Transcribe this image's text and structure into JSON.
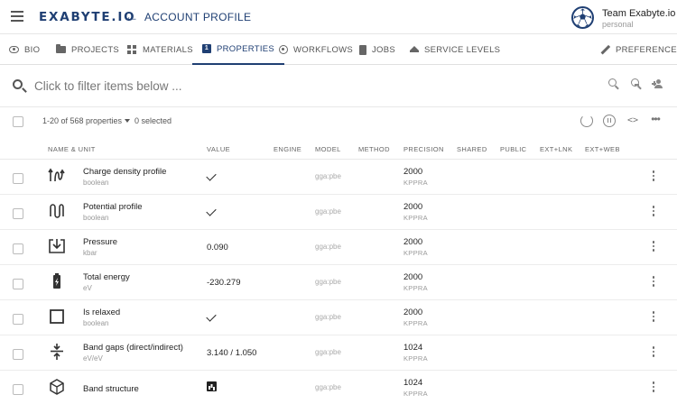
{
  "header": {
    "logo": "EXABYTE.IO",
    "page_title": "ACCOUNT PROFILE",
    "team_name": "Team Exabyte.io",
    "team_sub": "personal"
  },
  "tabs": [
    {
      "label": "BIO",
      "icon": "eye-icon"
    },
    {
      "label": "PROJECTS",
      "icon": "folder-icon"
    },
    {
      "label": "MATERIALS",
      "icon": "grid-icon"
    },
    {
      "label": "PROPERTIES",
      "icon": "one-icon",
      "active": true
    },
    {
      "label": "WORKFLOWS",
      "icon": "radio-icon"
    },
    {
      "label": "JOBS",
      "icon": "document-icon"
    },
    {
      "label": "SERVICE LEVELS",
      "icon": "layers-icon"
    },
    {
      "label": "PREFERENCES",
      "icon": "pencil-icon"
    }
  ],
  "search": {
    "placeholder": "Click to filter items below ..."
  },
  "toolbar": {
    "count_label": "1-20 of 568 properties",
    "selected_label": "0 selected"
  },
  "columns": [
    "NAME & UNIT",
    "VALUE",
    "ENGINE",
    "MODEL",
    "METHOD",
    "PRECISION",
    "SHARED",
    "PUBLIC",
    "EXT+LNK",
    "EXT+WEB"
  ],
  "rows": [
    {
      "name": "Charge density profile",
      "unit": "boolean",
      "value": "",
      "value_type": "check",
      "model": "gga:pbe",
      "precision": "2000",
      "precision_unit": "KPPRA",
      "icon": "charge-density-icon"
    },
    {
      "name": "Potential profile",
      "unit": "boolean",
      "value": "",
      "value_type": "check",
      "model": "gga:pbe",
      "precision": "2000",
      "precision_unit": "KPPRA",
      "icon": "potential-profile-icon"
    },
    {
      "name": "Pressure",
      "unit": "kbar",
      "value": "0.090",
      "value_type": "text",
      "model": "gga:pbe",
      "precision": "2000",
      "precision_unit": "KPPRA",
      "icon": "pressure-icon"
    },
    {
      "name": "Total energy",
      "unit": "eV",
      "value": "-230.279",
      "value_type": "text",
      "model": "gga:pbe",
      "precision": "2000",
      "precision_unit": "KPPRA",
      "icon": "battery-icon"
    },
    {
      "name": "Is relaxed",
      "unit": "boolean",
      "value": "",
      "value_type": "check",
      "model": "gga:pbe",
      "precision": "2000",
      "precision_unit": "KPPRA",
      "icon": "square-icon"
    },
    {
      "name": "Band gaps (direct/indirect)",
      "unit": "eV/eV",
      "value": "3.140 / 1.050",
      "value_type": "text",
      "model": "gga:pbe",
      "precision": "1024",
      "precision_unit": "KPPRA",
      "icon": "band-gap-icon"
    },
    {
      "name": "Band structure",
      "unit": "",
      "value": "",
      "value_type": "chart",
      "model": "gga:pbe",
      "precision": "1024",
      "precision_unit": "KPPRA",
      "icon": "cube-icon"
    }
  ],
  "colors": {
    "brand": "#1f3f73",
    "divider": "#e6e6e6"
  }
}
